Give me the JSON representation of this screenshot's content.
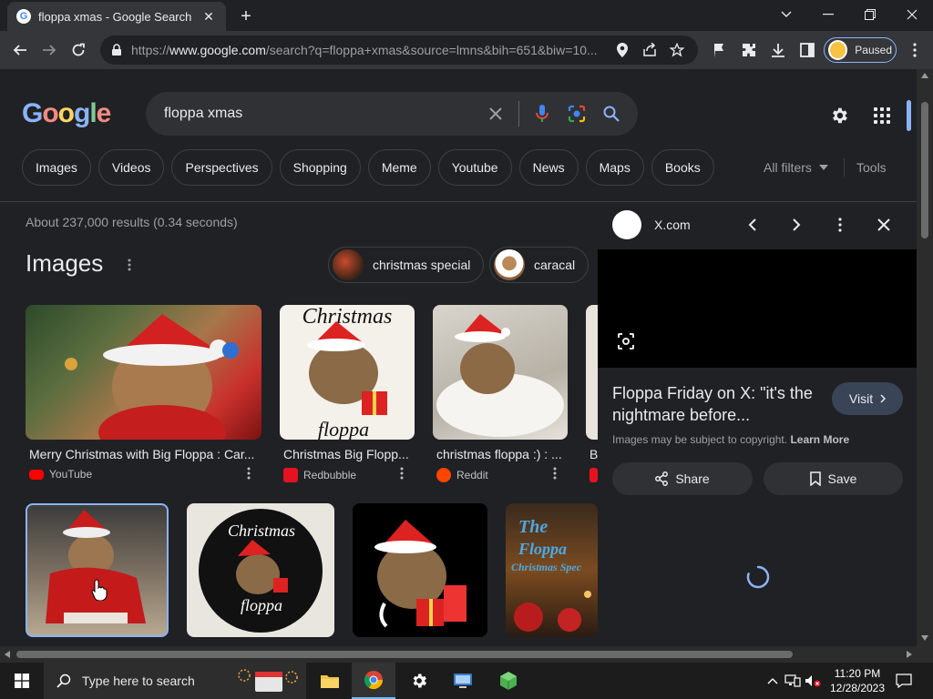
{
  "browser": {
    "tab_title": "floppa xmas - Google Search",
    "url_prefix": "https://",
    "url_domain": "www.google.com",
    "url_rest": "/search?q=floppa+xmas&source=lmns&bih=651&biw=10...",
    "profile_label": "Paused"
  },
  "search": {
    "logo": "Google",
    "query": "floppa xmas",
    "chips": [
      "Images",
      "Videos",
      "Perspectives",
      "Shopping",
      "Meme",
      "Youtube",
      "News",
      "Maps",
      "Books"
    ],
    "all_filters": "All filters",
    "tools": "Tools"
  },
  "results": {
    "count": "About 237,000 results (0.34 seconds)",
    "images_heading": "Images",
    "related_chips": [
      "christmas special",
      "caracal"
    ],
    "row1": [
      {
        "caption": "Merry Christmas with Big Floppa : Car...",
        "source": "YouTube"
      },
      {
        "caption": "Christmas Big Flopp...",
        "source": "Redbubble"
      },
      {
        "caption": "christmas floppa :) : ...",
        "source": "Reddit"
      },
      {
        "caption": "B",
        "source": ""
      }
    ],
    "overlay_texts": {
      "christmas_top": "Christmas",
      "floppa_bottom": "floppa",
      "round_christmas": "Christmas",
      "round_floppa": "floppa",
      "the": "The",
      "floppa_word": "Floppa",
      "christmas_spec": "Christmas Spec"
    }
  },
  "panel": {
    "site": "X.com",
    "title": "Floppa Friday on X: \"it's the nightmare before...",
    "visit": "Visit",
    "copyright": "Images may be subject to copyright.",
    "learn_more": "Learn More",
    "share": "Share",
    "save": "Save"
  },
  "taskbar": {
    "search_placeholder": "Type here to search",
    "time": "11:20 PM",
    "date": "12/28/2023"
  },
  "colors": {
    "background": "#202124",
    "accent": "#8ab4f8",
    "chip_border": "#3c4043"
  }
}
